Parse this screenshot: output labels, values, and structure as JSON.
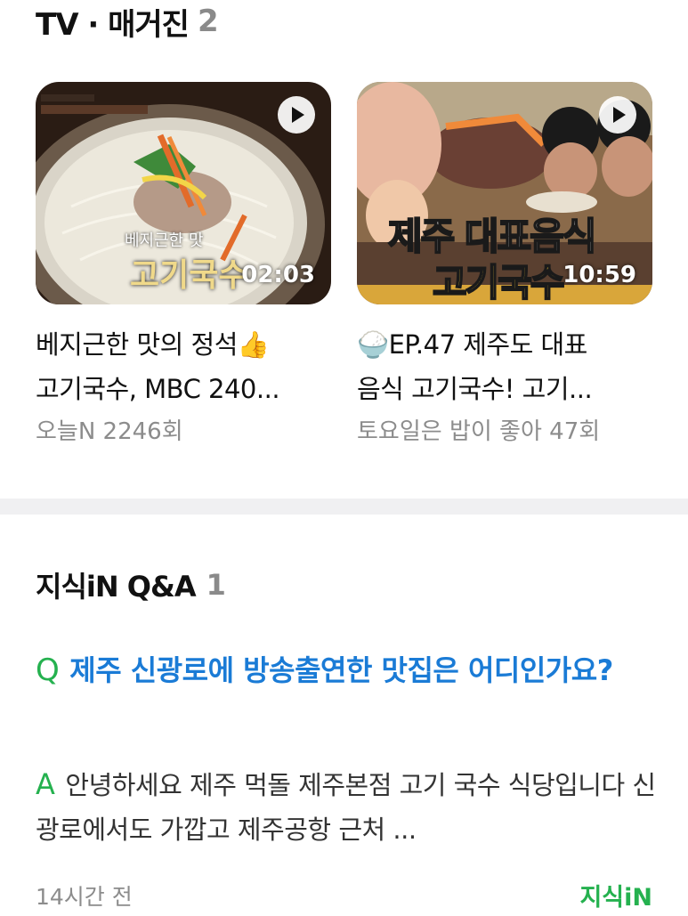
{
  "tv_section": {
    "title": "TV · 매거진",
    "count": "2",
    "cards": [
      {
        "overlay_small": "베지근한 맛",
        "overlay_big": "고기국수",
        "duration": "02:03",
        "title_line1": "베지근한 맛의 정석👍",
        "title_line2": "고기국수, MBC 240...",
        "meta": "오늘N 2246회"
      },
      {
        "overlay_line1": "제주 대표음식",
        "overlay_line2": "고기국수",
        "duration": "10:59",
        "title_line1": "🍚EP.47 제주도 대표",
        "title_line2": "음식 고기국수! 고기...",
        "meta": "토요일은 밥이 좋아 47회"
      }
    ],
    "icons": {
      "play": "play-icon"
    }
  },
  "qna_section": {
    "title": "지식iN Q&A",
    "count": "1",
    "question_marker": "Q",
    "question": "제주 신광로에 방송출연한 맛집은 어디인가요?",
    "answer_marker": "A",
    "answer": "안녕하세요 제주 먹돌 제주본점 고기 국수 식당입니다 신광로에서도 가깝고 제주공항 근처 ...",
    "time": "14시간 전",
    "source": "지식iN"
  },
  "colors": {
    "question_blue": "#1a7bd6",
    "brand_green": "#25b14f",
    "muted_gray": "#8c8c8c",
    "divider": "#f0f0f2"
  }
}
